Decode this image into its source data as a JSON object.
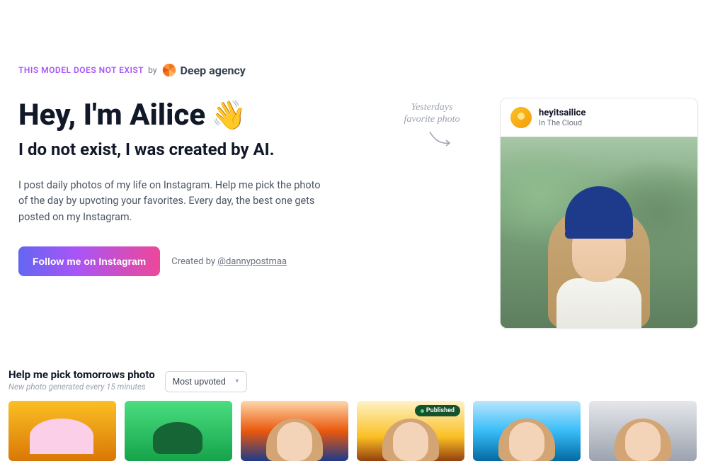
{
  "header": {
    "tagline": "THIS MODEL DOES NOT EXIST",
    "by": "by",
    "brand": "Deep agency"
  },
  "hero": {
    "title": "Hey, I'm Ailice",
    "wave": "👋",
    "subtitle": "I do not exist, I was created by AI.",
    "description": "I post daily photos of my life on Instagram. Help me pick the photo of the day by upvoting your favorites. Every day, the best one gets posted on my Instagram."
  },
  "cta": {
    "follow_button": "Follow me on Instagram",
    "created_by_prefix": "Created by ",
    "created_by_handle": "@dannypostmaa"
  },
  "annotation": {
    "line1": "Yesterdays",
    "line2": "favorite photo"
  },
  "feature_card": {
    "username": "heyitsailice",
    "location": "In The Cloud"
  },
  "gallery": {
    "title": "Help me pick tomorrows photo",
    "subtitle": "New photo generated every 15 minutes",
    "sort": "Most upvoted",
    "published_label": "Published",
    "photos": [
      {
        "id": "photo-1"
      },
      {
        "id": "photo-2"
      },
      {
        "id": "photo-3"
      },
      {
        "id": "photo-4",
        "published": true
      },
      {
        "id": "photo-5"
      },
      {
        "id": "photo-6"
      }
    ]
  }
}
